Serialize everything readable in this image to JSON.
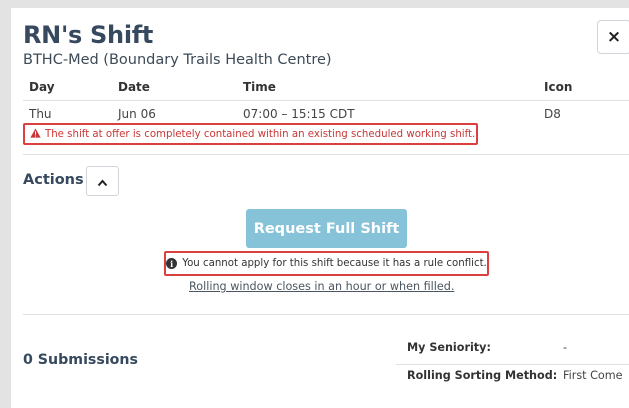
{
  "modal": {
    "title": "RN's Shift",
    "subtitle": "BTHC-Med (Boundary Trails Health Centre)",
    "close_label": "×"
  },
  "table": {
    "headers": [
      "Day",
      "Date",
      "Time",
      "Icon"
    ],
    "row": {
      "day": "Thu",
      "date": "Jun 06",
      "time": "07:00 – 15:15 CDT",
      "icon": "D8"
    }
  },
  "warning": {
    "icon": "warning-triangle-icon",
    "text": "The shift at offer is completely contained within an existing scheduled working shift."
  },
  "actions": {
    "label": "Actions",
    "request_button": "Request Full Shift",
    "info_icon": "info-circle-icon",
    "info_text": "You cannot apply for this shift because it has a rule conflict.",
    "rolling_text": "Rolling window closes in an hour or when filled."
  },
  "submissions": {
    "label": "0 Submissions"
  },
  "details": {
    "seniority_label": "My Seniority:",
    "seniority_value": "-",
    "sorting_label": "Rolling Sorting Method:",
    "sorting_value": "First Come"
  },
  "colors": {
    "background": "#e3e3e3",
    "accent_button": "#86c3d8",
    "alert_red": "#d9403f",
    "heading": "#36495e"
  }
}
